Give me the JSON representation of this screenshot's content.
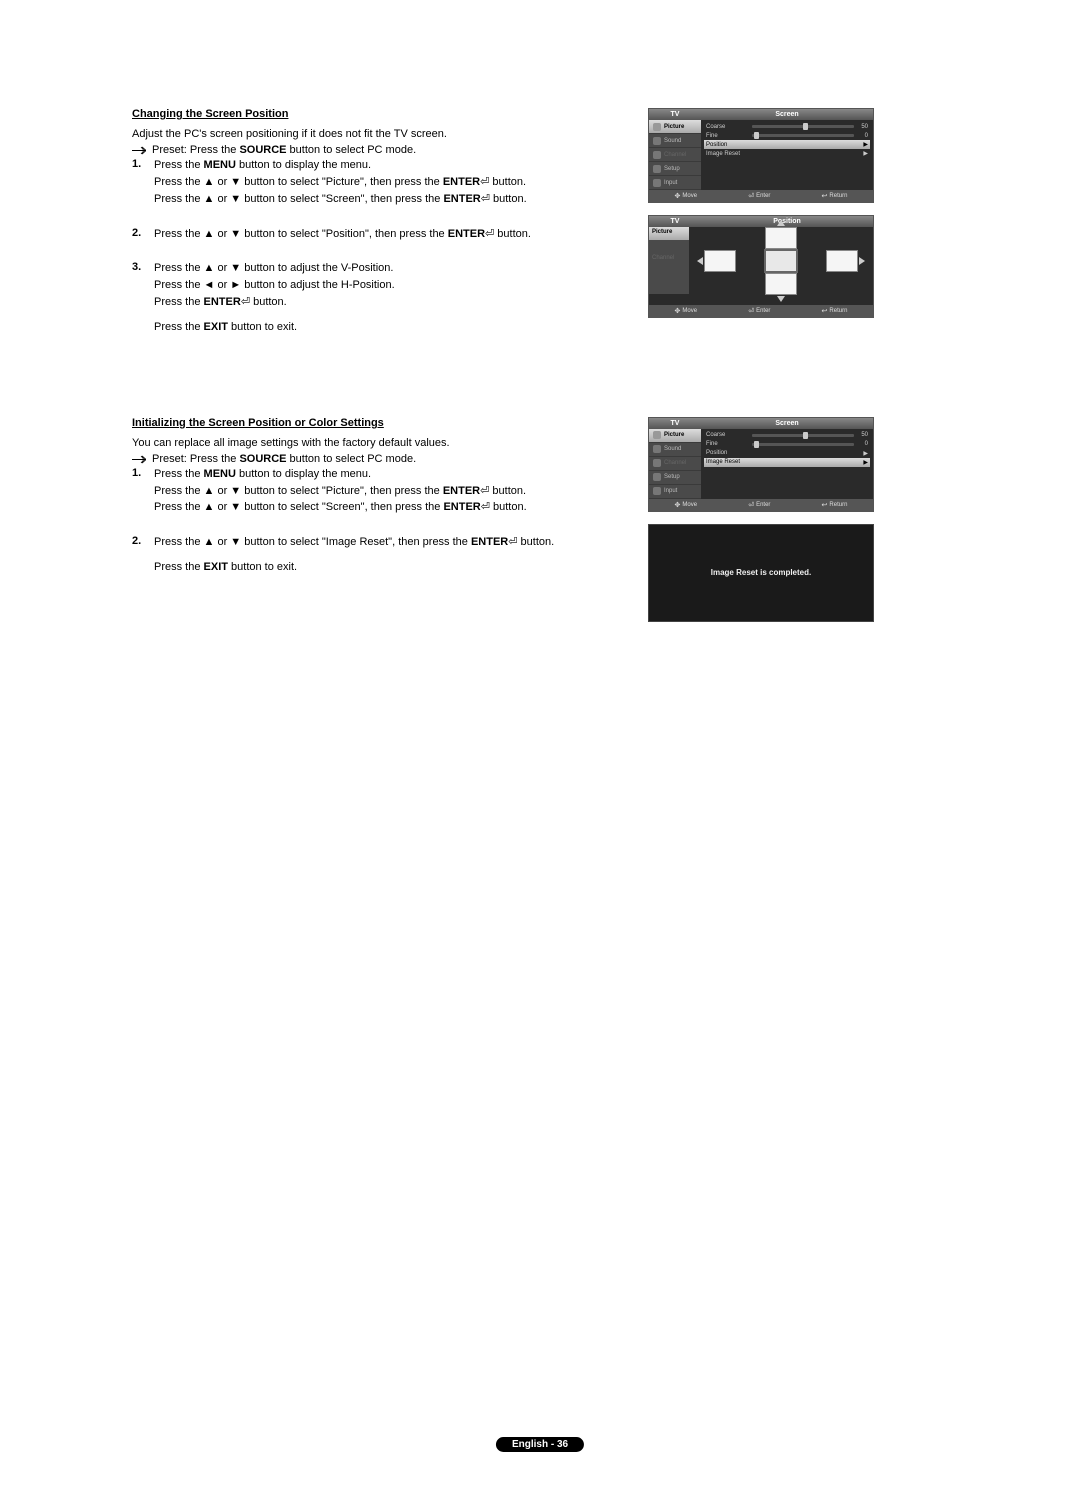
{
  "section1": {
    "title": "Changing the Screen Position",
    "intro": "Adjust the PC's screen positioning if it does not fit the TV screen.",
    "preset_prefix": "Preset: Press the ",
    "preset_bold": "SOURCE",
    "preset_suffix": " button to select PC mode.",
    "step1": {
      "num": "1.",
      "l1a": "Press the ",
      "l1b": "MENU",
      "l1c": " button to display the menu.",
      "l2a": "Press the ▲ or ▼ button to select \"Picture\", then press the ",
      "l2b": "ENTER",
      "l2c": " button.",
      "l3a": "Press the ▲ or ▼ button to select \"Screen\", then press the ",
      "l3b": "ENTER",
      "l3c": " button."
    },
    "step2": {
      "num": "2.",
      "l1a": "Press the ▲ or ▼ button to select \"Position\", then press the ",
      "l1b": "ENTER",
      "l1c": " button."
    },
    "step3": {
      "num": "3.",
      "l1": "Press the ▲ or ▼ button to adjust the V-Position.",
      "l2": "Press the ◄ or ► button to adjust the H-Position.",
      "l3a": "Press the ",
      "l3b": "ENTER",
      "l3c": " button.",
      "l4a": "Press the ",
      "l4b": "EXIT",
      "l4c": " button to exit."
    }
  },
  "section2": {
    "title": "Initializing the Screen Position or Color Settings",
    "intro": "You can replace all image settings with the factory default values.",
    "preset_prefix": "Preset: Press the ",
    "preset_bold": "SOURCE",
    "preset_suffix": " button to select PC mode.",
    "step1": {
      "num": "1.",
      "l1a": "Press the ",
      "l1b": "MENU",
      "l1c": " button to display the menu.",
      "l2a": "Press the ▲ or ▼ button to select \"Picture\", then press the ",
      "l2b": "ENTER",
      "l2c": " button.",
      "l3a": "Press the ▲ or ▼ button to select \"Screen\", then press the ",
      "l3b": "ENTER",
      "l3c": " button."
    },
    "step2": {
      "num": "2.",
      "l1a": "Press the ▲ or ▼ button to select \"Image Reset\", then press the ",
      "l1b": "ENTER",
      "l1c": " button.",
      "l2a": "Press the ",
      "l2b": "EXIT",
      "l2c": " button to exit."
    }
  },
  "osd_screen": {
    "tv": "TV",
    "title": "Screen",
    "side": {
      "picture": "Picture",
      "sound": "Sound",
      "channel": "Channel",
      "setup": "Setup",
      "input": "Input"
    },
    "rows": {
      "coarse": "Coarse",
      "coarse_val": "50",
      "fine": "Fine",
      "fine_val": "0",
      "position": "Position",
      "imagereset": "Image Reset"
    },
    "footer": {
      "move": "Move",
      "enter": "Enter",
      "return": "Return"
    }
  },
  "osd_position": {
    "tv": "TV",
    "title": "Position",
    "side": {
      "picture": "Picture",
      "channel": "Channel"
    },
    "footer": {
      "move": "Move",
      "enter": "Enter",
      "return": "Return"
    }
  },
  "osd_reset_msg": "Image Reset is completed.",
  "enter_sym": "⏎",
  "return_sym": "↩",
  "move_sym": "✥",
  "page_footer": "English - 36"
}
